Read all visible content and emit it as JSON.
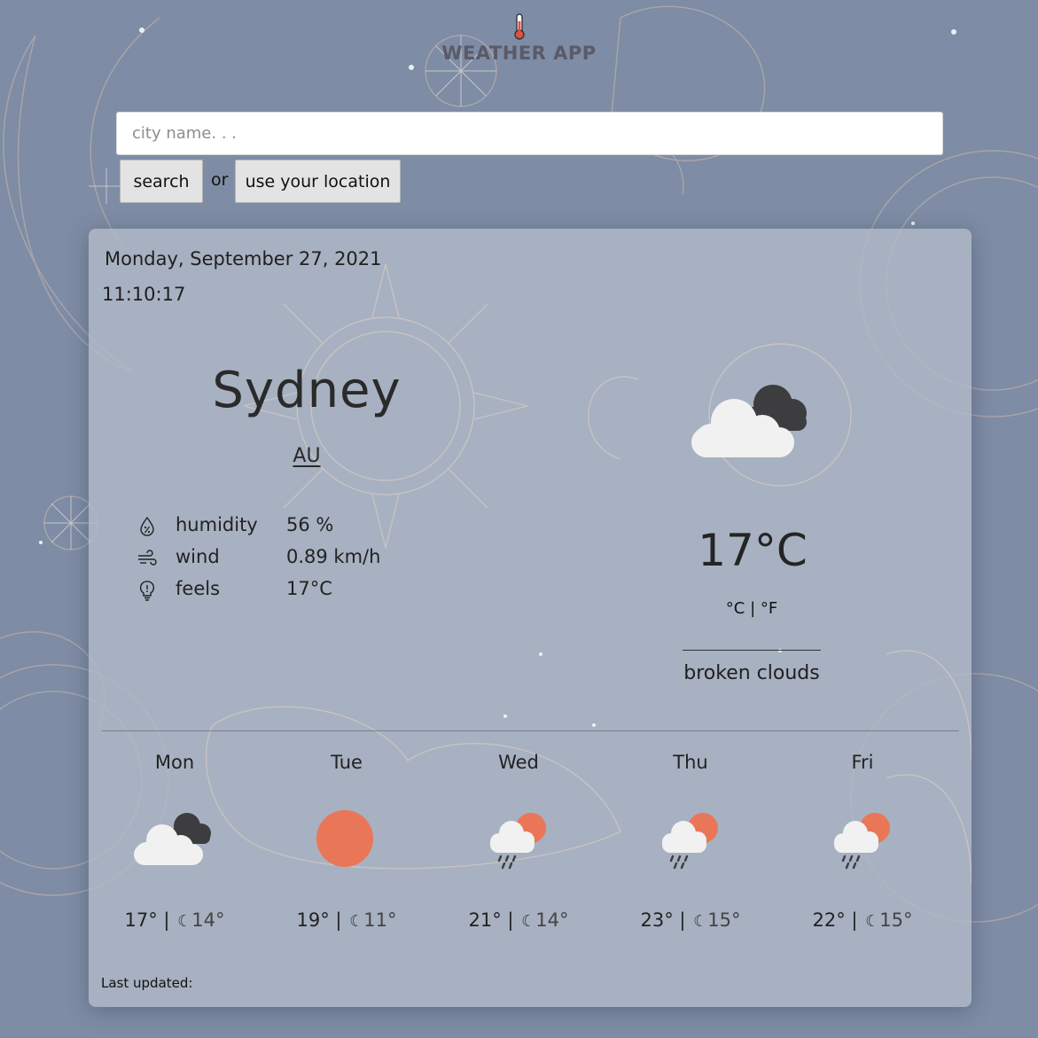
{
  "header": {
    "title": "WEATHER APP",
    "icon": "thermometer-icon"
  },
  "search": {
    "placeholder": "city name. . .",
    "value": "",
    "search_label": "search",
    "or_label": "or",
    "location_label": "use your location"
  },
  "current": {
    "date": "Monday, September 27, 2021",
    "time": "11:10:17",
    "city": "Sydney",
    "country": "AU",
    "temperature": "17°C",
    "units": "°C | °F",
    "description": "broken clouds",
    "icon": "broken-clouds-icon",
    "details": [
      {
        "icon": "humidity-icon",
        "label": "humidity",
        "value": "56 %"
      },
      {
        "icon": "wind-icon",
        "label": "wind",
        "value": "0.89 km/h"
      },
      {
        "icon": "feels-like-icon",
        "label": "feels",
        "value": "17°C"
      }
    ]
  },
  "forecast": [
    {
      "day": "Mon",
      "icon": "broken-clouds-icon",
      "high": "17°",
      "low": "14°"
    },
    {
      "day": "Tue",
      "icon": "sun-icon",
      "high": "19°",
      "low": "11°"
    },
    {
      "day": "Wed",
      "icon": "rain-sun-icon",
      "high": "21°",
      "low": "14°"
    },
    {
      "day": "Thu",
      "icon": "rain-sun-icon",
      "high": "23°",
      "low": "15°"
    },
    {
      "day": "Fri",
      "icon": "rain-sun-icon",
      "high": "22°",
      "low": "15°"
    }
  ],
  "footer": {
    "last_updated_label": "Last updated:"
  },
  "colors": {
    "background": "#7e8ca5",
    "card": "#b2bac8",
    "sun": "#ea7658",
    "cloud_light": "#f1f1f1",
    "cloud_dark": "#3d3d3f"
  }
}
